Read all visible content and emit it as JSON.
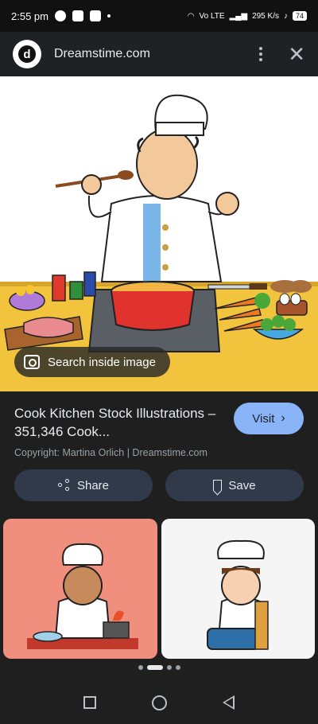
{
  "status_bar": {
    "time": "2:55 pm",
    "network": "Vo LTE",
    "speed": "295 K/s",
    "battery": "74"
  },
  "header": {
    "site_name": "Dreamstime.com",
    "logo_letter": "d"
  },
  "image": {
    "lens_label": "Search inside image"
  },
  "info": {
    "title": "Cook Kitchen Stock Illustrations – 351,346 Cook...",
    "copyright": "Copyright: Martina Orlich | Dreamstime.com",
    "visit_label": "Visit"
  },
  "actions": {
    "share_label": "Share",
    "save_label": "Save"
  },
  "colors": {
    "visit_button": "#8ab4f8",
    "action_button": "#303a4a",
    "background": "#1f1f1f"
  }
}
